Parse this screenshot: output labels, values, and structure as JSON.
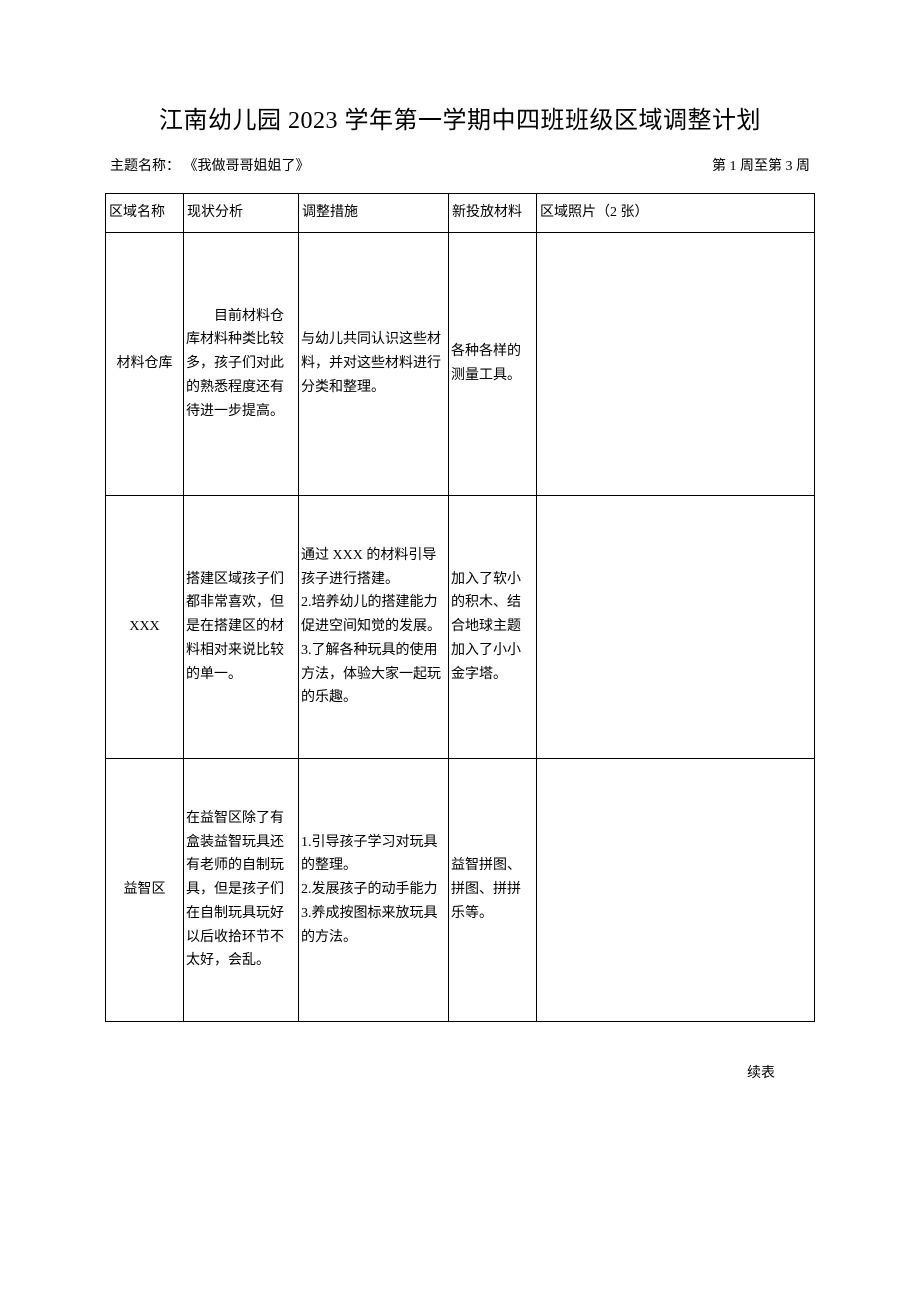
{
  "title": "江南幼儿园 2023 学年第一学期中四班班级区域调整计划",
  "subheader": {
    "theme_label": "主题名称：",
    "theme_name": "《我做哥哥姐姐了》",
    "week_range": "第 1 周至第 3 周"
  },
  "headers": {
    "area": "区域名称",
    "analysis": "现状分析",
    "measures": "调整措施",
    "materials": "新投放材料",
    "photos": "区域照片（2 张）"
  },
  "rows": [
    {
      "area": "材料仓库",
      "analysis": "　　目前材料仓库材料种类比较多，孩子们对此的熟悉程度还有待进一步提高。",
      "measures": "与幼儿共同认识这些材料，并对这些材料进行分类和整理。",
      "materials": "各种各样的测量工具。",
      "photos": ""
    },
    {
      "area": "XXX",
      "analysis": "搭建区域孩子们都非常喜欢，但是在搭建区的材料相对来说比较的单一。",
      "measures": "通过 XXX 的材料引导孩子进行搭建。\n2.培养幼儿的搭建能力促进空间知觉的发展。\n3.了解各种玩具的使用方法，体验大家一起玩的乐趣。",
      "materials": "加入了软小的积木、结合地球主题加入了小小金字塔。",
      "photos": ""
    },
    {
      "area": "益智区",
      "analysis": "在益智区除了有盒装益智玩具还有老师的自制玩具，但是孩子们在自制玩具玩好以后收拾环节不太好，会乱。",
      "measures": "1.引导孩子学习对玩具的整理。\n2.发展孩子的动手能力\n3.养成按图标来放玩具的方法。",
      "materials": "益智拼图、拼图、拼拼乐等。",
      "photos": ""
    }
  ],
  "footer": "续表"
}
